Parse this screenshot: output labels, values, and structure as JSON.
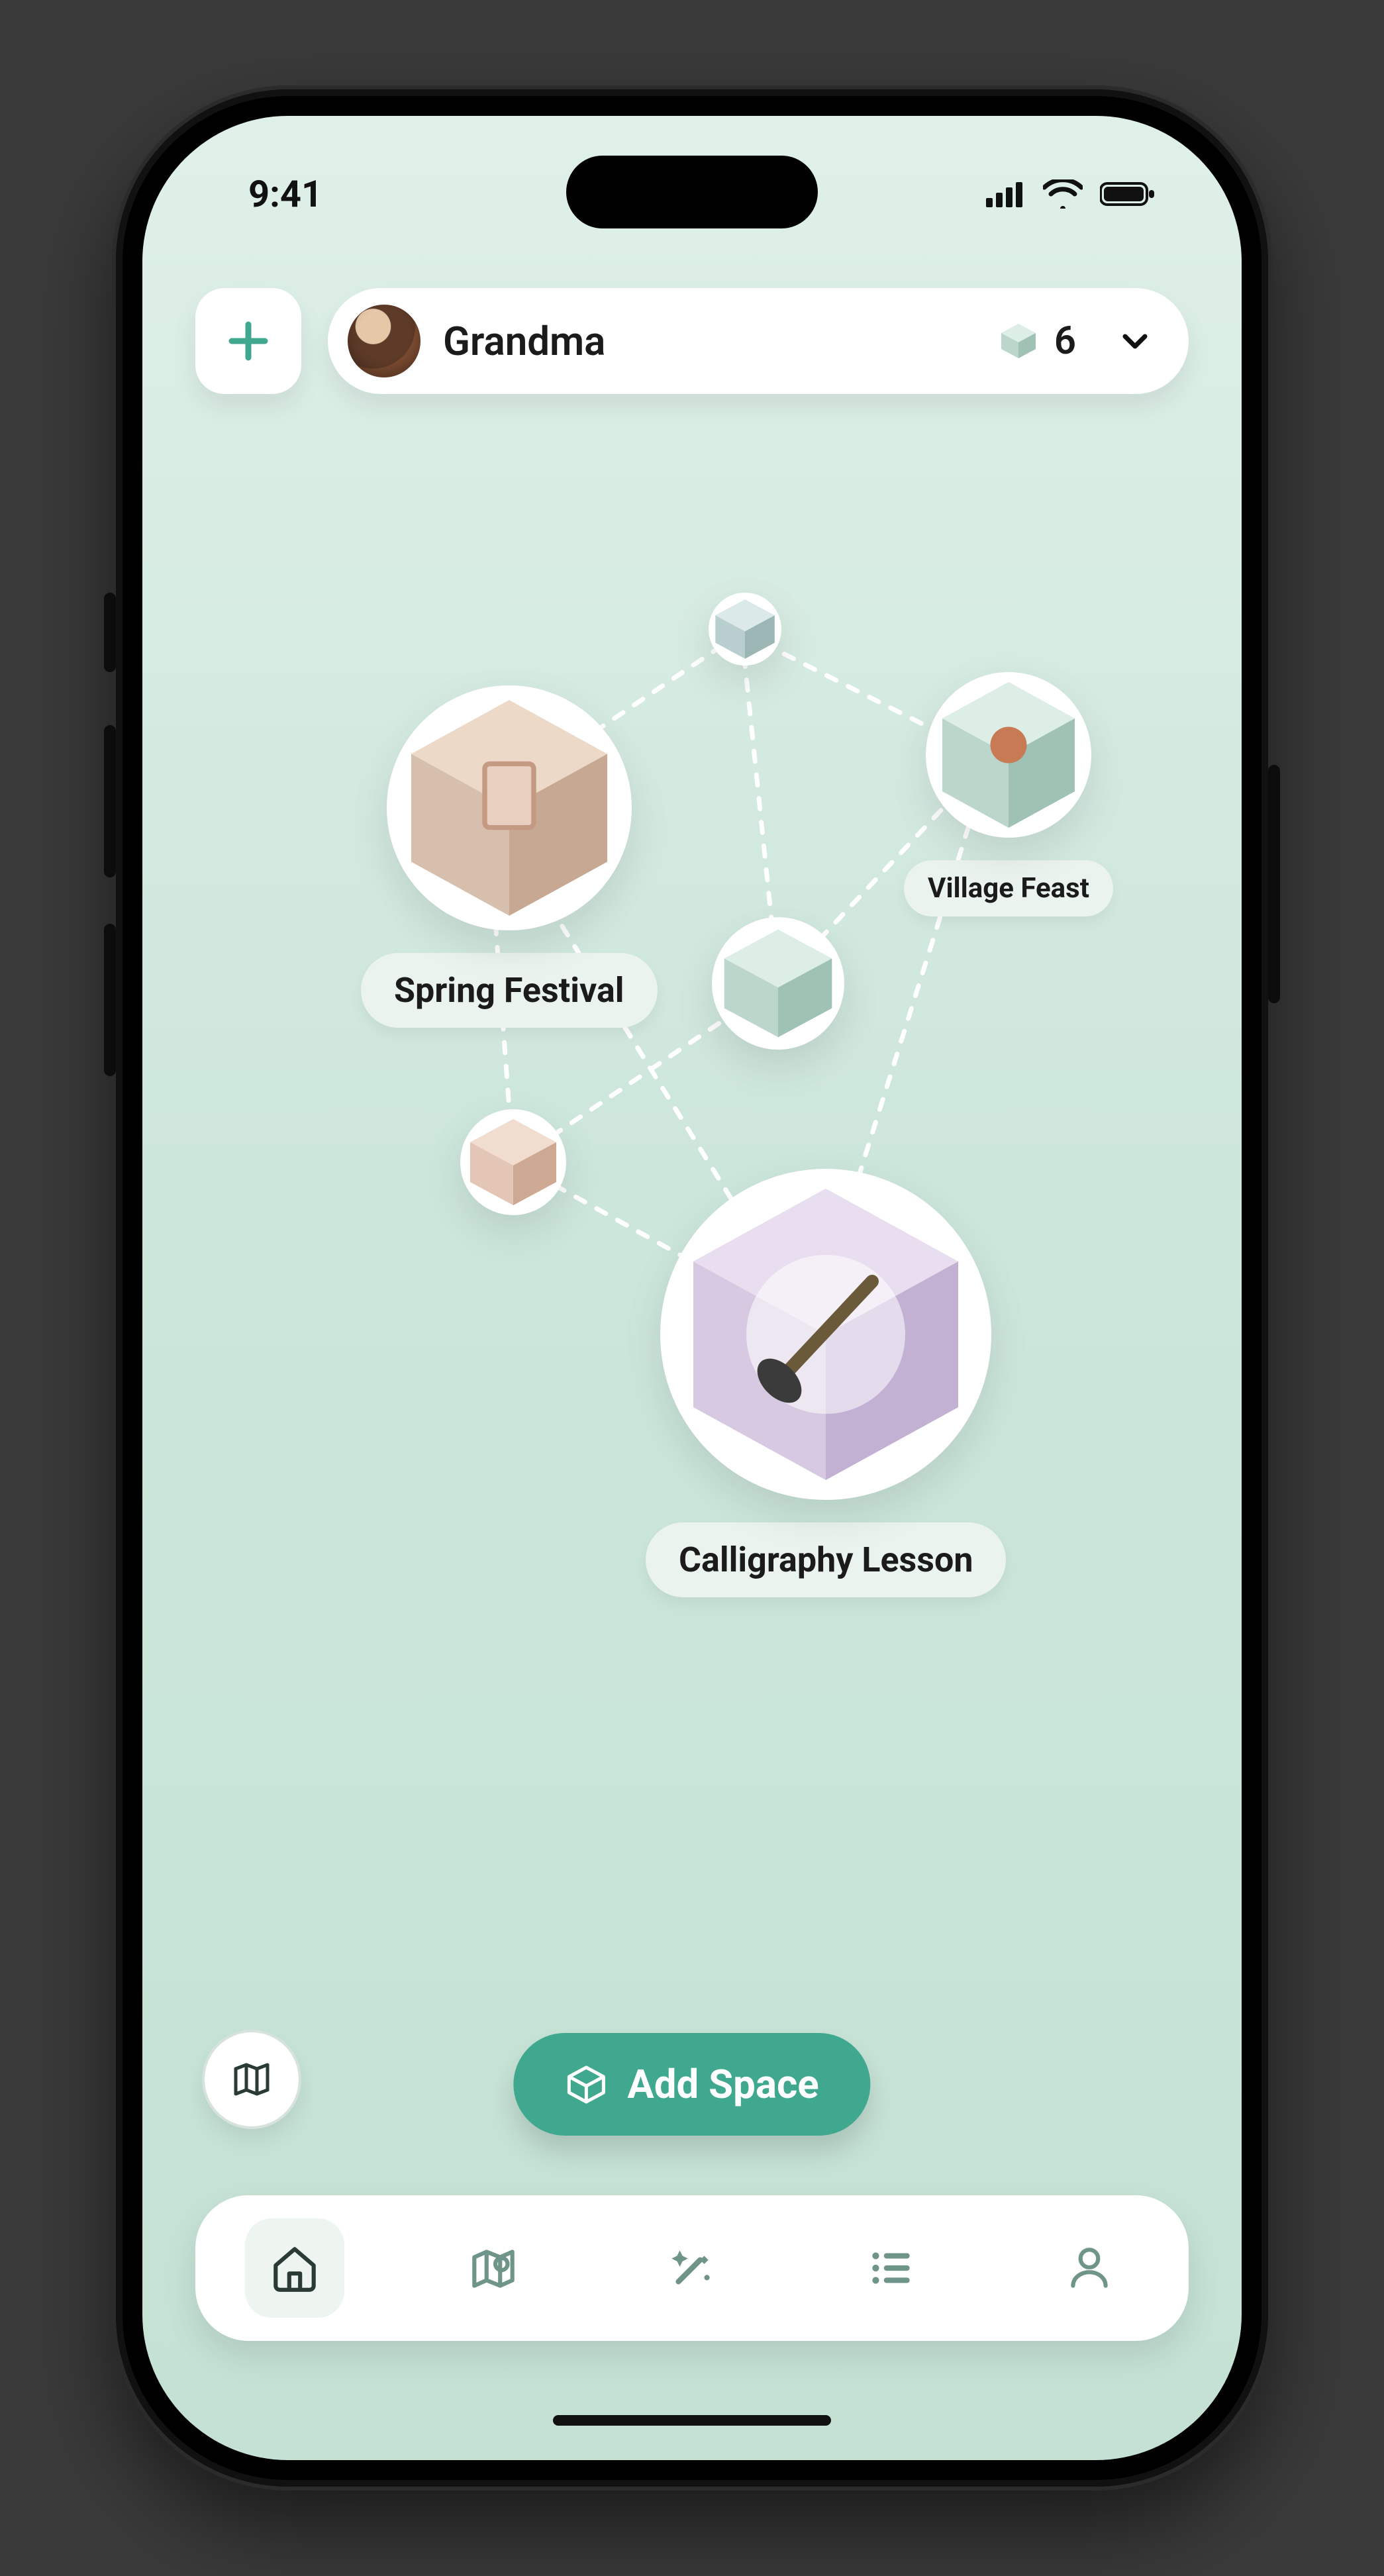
{
  "status": {
    "time": "9:41"
  },
  "header": {
    "profile_name": "Grandma",
    "count": "6"
  },
  "nodes": {
    "spring_festival": {
      "label": "Spring Festival"
    },
    "village_feast": {
      "label": "Village Feast"
    },
    "calligraphy": {
      "label": "Calligraphy Lesson"
    }
  },
  "actions": {
    "add_space": "Add Space"
  },
  "colors": {
    "accent": "#3fa88e",
    "muted_icon": "#6f9489",
    "active_icon": "#2a3b35"
  }
}
